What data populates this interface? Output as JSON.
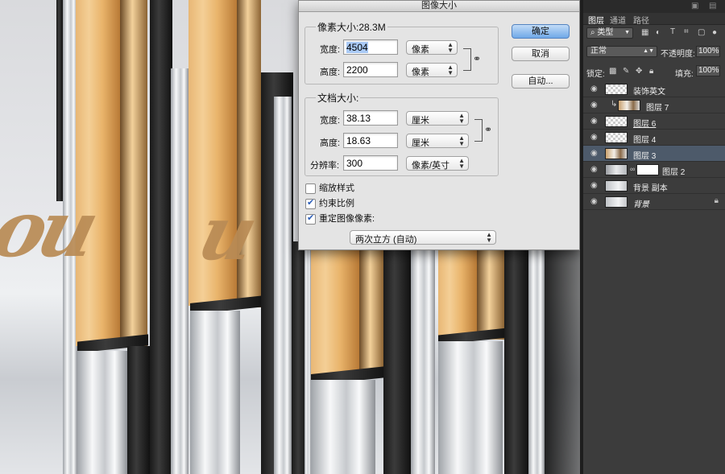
{
  "dialog": {
    "title": "图像大小",
    "pixel_dimensions": {
      "title": "像素大小:28.3M",
      "width_label": "宽度:",
      "width_value": "4504",
      "width_unit": "像素",
      "height_label": "高度:",
      "height_value": "2200",
      "height_unit": "像素"
    },
    "document_size": {
      "title": "文档大小:",
      "width_label": "宽度:",
      "width_value": "38.13",
      "width_unit": "厘米",
      "height_label": "高度:",
      "height_value": "18.63",
      "height_unit": "厘米",
      "resolution_label": "分辨率:",
      "resolution_value": "300",
      "resolution_unit": "像素/英寸"
    },
    "options": {
      "scale_styles": {
        "label": "缩放样式",
        "checked": false
      },
      "constrain_proportions": {
        "label": "约束比例",
        "checked": true
      },
      "resample": {
        "label": "重定图像像素:",
        "checked": true
      }
    },
    "resample_method": "两次立方 (自动)",
    "buttons": {
      "ok": "确定",
      "cancel": "取消",
      "auto": "自动..."
    }
  },
  "layers_panel": {
    "tabs": [
      "图层",
      "通道",
      "路径"
    ],
    "filter_type": "类型",
    "blend_mode": "正常",
    "opacity_label": "不透明度:",
    "opacity_value": "100%",
    "lock_label": "锁定:",
    "fill_label": "填充:",
    "fill_value": "100%",
    "layers": [
      {
        "name": "装饰英文",
        "thumb": "transparent"
      },
      {
        "name": "图层 7",
        "thumb": "photo",
        "clipped": true
      },
      {
        "name": "图层 6",
        "thumb": "transparent"
      },
      {
        "name": "图层 4",
        "thumb": "transparent"
      },
      {
        "name": "图层 3",
        "thumb": "photo",
        "selected": true
      },
      {
        "name": "图层 2",
        "thumb": "gradient",
        "mask": true
      },
      {
        "name": "背景 副本",
        "thumb": "background"
      },
      {
        "name": "背景",
        "thumb": "background",
        "locked": true
      }
    ]
  }
}
